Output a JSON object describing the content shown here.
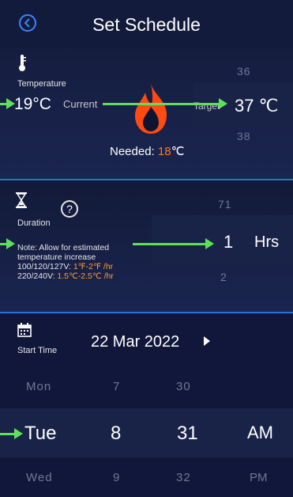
{
  "header": {
    "title": "Set Schedule"
  },
  "temperature": {
    "label": "Temperature",
    "current_value": "19°C",
    "current_label": "Current",
    "target_label": "Target",
    "target_value": "37 ℃",
    "above": "36",
    "below": "38",
    "needed_label": "Needed: ",
    "needed_value": "18",
    "needed_unit": "℃"
  },
  "duration": {
    "label": "Duration",
    "help_glyph": "?",
    "above": "71",
    "value": "1",
    "unit": "Hrs",
    "below": "2",
    "note_line1": "Note: Allow for estimated",
    "note_line2": "temperature increase",
    "rate1_label": "100/120/127V: ",
    "rate1_value": "1℉-2℉ /hr",
    "rate2_label": "220/240V: ",
    "rate2_value": "1.5℃-2.5℃ /hr"
  },
  "start_time": {
    "label": "Start Time",
    "date": "22 Mar 2022",
    "rows": [
      {
        "day": "Mon",
        "hour": "7",
        "minute": "30",
        "ampm": ""
      },
      {
        "day": "Tue",
        "hour": "8",
        "minute": "31",
        "ampm": "AM"
      },
      {
        "day": "Wed",
        "hour": "9",
        "minute": "32",
        "ampm": "PM"
      }
    ]
  },
  "colors": {
    "background": "#0e1530",
    "accent_blue": "#3a86ff",
    "arrow_green": "#5fe05a",
    "needed_orange": "#ff7a1a",
    "rate_orange": "#ff9a2e"
  },
  "icons": [
    "back-icon",
    "thermometer-icon",
    "flame-icon",
    "hourglass-icon",
    "help-icon",
    "calendar-icon",
    "chevron-right-icon"
  ]
}
